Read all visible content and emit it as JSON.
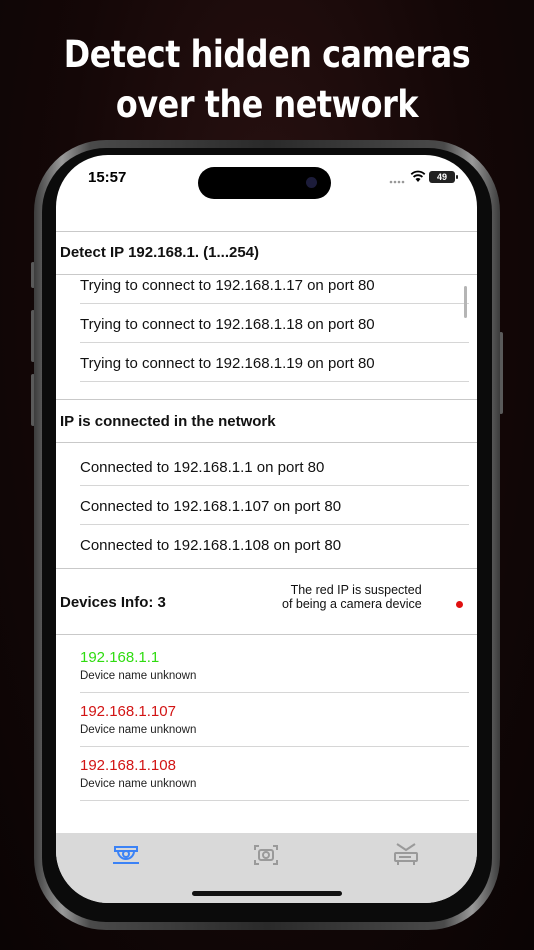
{
  "headline": {
    "line1": "Detect hidden cameras",
    "line2": "over the network"
  },
  "status_bar": {
    "time": "15:57",
    "battery": "49"
  },
  "detect_section": {
    "title": "Detect IP 192.168.1.  (1...254)",
    "rows": [
      "Trying to connect to 192.168.1.17 on port 80",
      "Trying to connect to 192.168.1.18 on port 80",
      "Trying to connect to 192.168.1.19 on port 80"
    ]
  },
  "connected_section": {
    "title": "IP is connected in the network",
    "rows": [
      "Connected to 192.168.1.1 on port 80",
      "Connected to 192.168.1.107 on port 80",
      "Connected to 192.168.1.108 on port 80"
    ]
  },
  "devices_section": {
    "title": "Devices Info: 3",
    "note_line1": "The red IP is suspected",
    "note_line2": "of being a camera device",
    "devices": [
      {
        "ip": "192.168.1.1",
        "name": "Device name unknown",
        "status_color": "#2fdc10"
      },
      {
        "ip": "192.168.1.107",
        "name": "Device name unknown",
        "status_color": "#d21414"
      },
      {
        "ip": "192.168.1.108",
        "name": "Device name unknown",
        "status_color": "#d21414"
      }
    ]
  },
  "tabs": [
    {
      "icon": "security-camera-icon",
      "active": true
    },
    {
      "icon": "scan-camera-icon",
      "active": false
    },
    {
      "icon": "router-icon",
      "active": false
    }
  ],
  "colors": {
    "active_tab": "#3b82f6",
    "inactive_tab": "#9a9a9a",
    "suspect": "#d21414",
    "safe": "#2fdc10"
  }
}
